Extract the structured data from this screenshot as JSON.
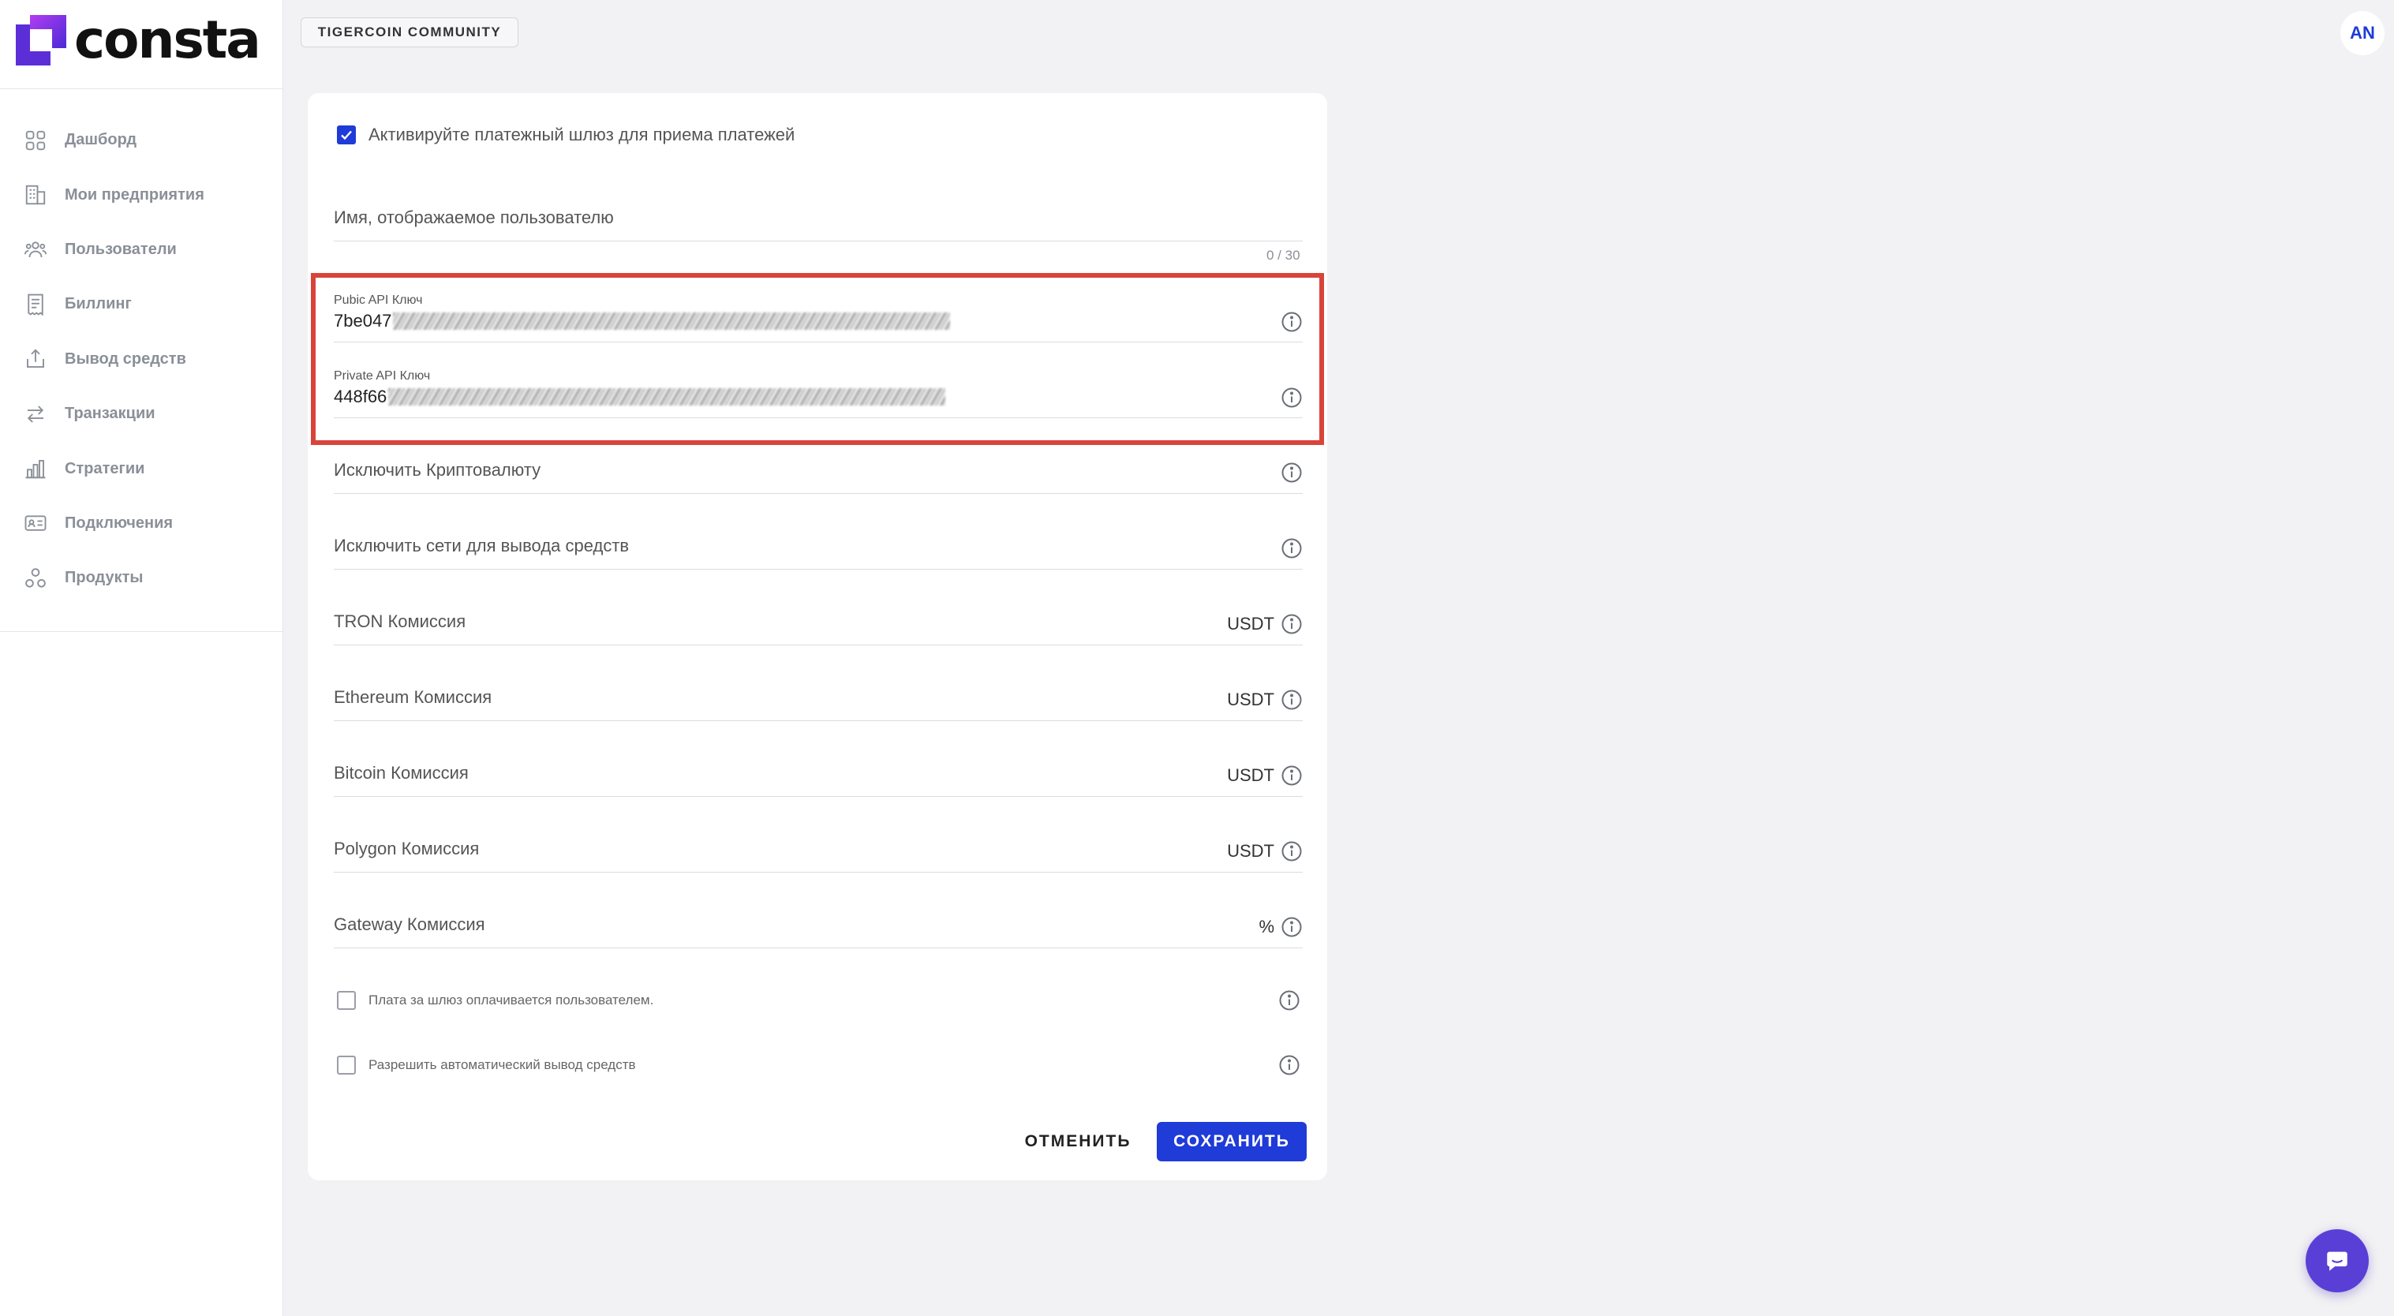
{
  "brand": {
    "name": "consta",
    "logo_colors": [
      "#a23cf0",
      "#5b2ed8"
    ]
  },
  "header": {
    "community_label": "TIGERCOIN COMMUNITY",
    "avatar_initials": "AN"
  },
  "sidebar": {
    "items": [
      {
        "label": "Дашборд",
        "icon": "dashboard-icon"
      },
      {
        "label": "Мои предприятия",
        "icon": "building-icon"
      },
      {
        "label": "Пользователи",
        "icon": "users-icon"
      },
      {
        "label": "Биллинг",
        "icon": "receipt-icon"
      },
      {
        "label": "Вывод средств",
        "icon": "withdraw-icon"
      },
      {
        "label": "Транзакции",
        "icon": "transfer-icon"
      },
      {
        "label": "Стратегии",
        "icon": "bar-chart-icon"
      },
      {
        "label": "Подключения",
        "icon": "id-card-icon"
      },
      {
        "label": "Продукты",
        "icon": "shapes-icon"
      }
    ]
  },
  "form": {
    "activate_label": "Активируйте платежный шлюз для приема платежей",
    "activate_checked": true,
    "display_name": {
      "label": "Имя, отображаемое пользователю",
      "value": "",
      "counter": "0 / 30"
    },
    "public_api": {
      "label": "Pubic API Ключ",
      "value_prefix": "7be047"
    },
    "private_api": {
      "label": "Private API Ключ",
      "value_prefix": "448f66"
    },
    "exclude_crypto": {
      "label": "Исключить Криптовалюту"
    },
    "exclude_networks": {
      "label": "Исключить сети для вывода средств"
    },
    "tron_fee": {
      "label": "TRON Комиссия",
      "unit": "USDT"
    },
    "ethereum_fee": {
      "label": "Ethereum Комиссия",
      "unit": "USDT"
    },
    "bitcoin_fee": {
      "label": "Bitcoin Комиссия",
      "unit": "USDT"
    },
    "polygon_fee": {
      "label": "Polygon Комиссия",
      "unit": "USDT"
    },
    "gateway_fee": {
      "label": "Gateway Комиссия",
      "unit": "%"
    },
    "user_pays_fee": {
      "label": "Плата за шлюз оплачивается пользователем.",
      "checked": false
    },
    "auto_withdraw": {
      "label": "Разрешить автоматический вывод средств",
      "checked": false
    },
    "cancel_label": "ОТМЕНИТЬ",
    "save_label": "СОХРАНИТЬ"
  },
  "colors": {
    "accent": "#1f3bd8",
    "highlight": "#d9443a",
    "chat": "#5a3fd6"
  }
}
